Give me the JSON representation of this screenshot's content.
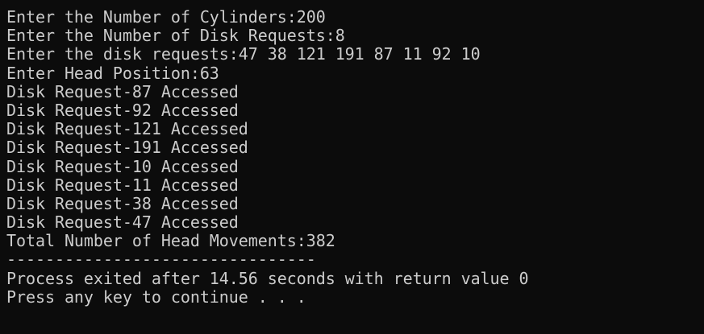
{
  "console": {
    "lines": [
      "Enter the Number of Cylinders:200",
      "Enter the Number of Disk Requests:8",
      "Enter the disk requests:47 38 121 191 87 11 92 10",
      "Enter Head Position:63",
      "Disk Request-87 Accessed",
      "Disk Request-92 Accessed",
      "Disk Request-121 Accessed",
      "Disk Request-191 Accessed",
      "Disk Request-10 Accessed",
      "Disk Request-11 Accessed",
      "Disk Request-38 Accessed",
      "Disk Request-47 Accessed",
      "Total Number of Head Movements:382",
      "--------------------------------",
      "Process exited after 14.56 seconds with return value 0",
      "Press any key to continue . . ."
    ]
  },
  "colors": {
    "background": "#0c0c0c",
    "text": "#cccccc"
  }
}
